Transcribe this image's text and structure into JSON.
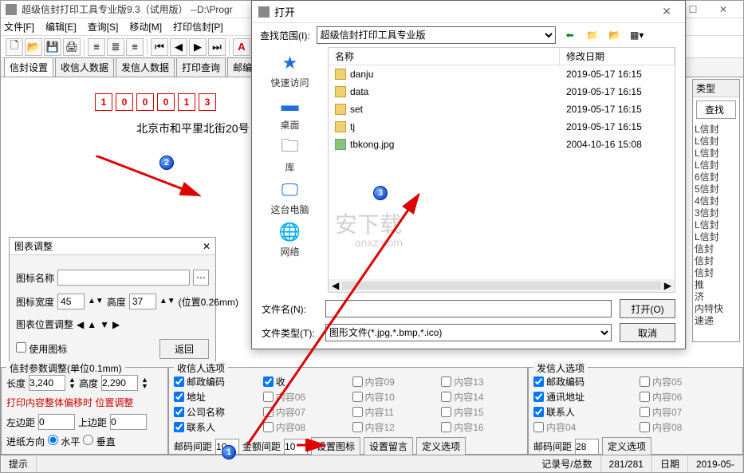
{
  "window": {
    "title": "超级信封打印工具专业版9.3（试用版）  --D:\\Progr"
  },
  "menu": [
    "文件[F]",
    "编辑[E]",
    "查询[S]",
    "移动[M]",
    "打印信封[P]"
  ],
  "tabs": [
    "信封设置",
    "收信人数据",
    "发信人数据",
    "打印查询",
    "邮编查"
  ],
  "postal": [
    "1",
    "0",
    "0",
    "0",
    "1",
    "3"
  ],
  "address": "北京市和平里北街20号",
  "chartPanel": {
    "title": "图表调整",
    "iconLabel": "图标名称",
    "widthLabel": "图标宽度",
    "widthVal": "45",
    "heightLabel": "高度",
    "heightVal": "37",
    "unit": "(位置0.26mm)",
    "posLabel": "图表位置调整",
    "useIcon": "使用图标",
    "back": "返回"
  },
  "dialog": {
    "title": "打开",
    "lookupLabel": "查找范围(I):",
    "lookupVal": "超级信封打印工具专业版",
    "side": [
      {
        "icon": "★",
        "label": "快速访问",
        "color": "#1e6fd9"
      },
      {
        "icon": "▬",
        "label": "桌面",
        "color": "#1e6fd9"
      },
      {
        "icon": "🗀",
        "label": "库",
        "color": "#555"
      },
      {
        "icon": "🖵",
        "label": "这台电脑",
        "color": "#1e6fd9"
      },
      {
        "icon": "🌐",
        "label": "网络",
        "color": "#1e6fd9"
      }
    ],
    "cols": {
      "name": "名称",
      "date": "修改日期"
    },
    "files": [
      {
        "name": "danju",
        "date": "2019-05-17 16:15",
        "type": "folder"
      },
      {
        "name": "data",
        "date": "2019-05-17 16:15",
        "type": "folder"
      },
      {
        "name": "set",
        "date": "2019-05-17 16:15",
        "type": "folder"
      },
      {
        "name": "tj",
        "date": "2019-05-17 16:15",
        "type": "folder"
      },
      {
        "name": "tbkong.jpg",
        "date": "2004-10-16 15:08",
        "type": "img"
      }
    ],
    "fileNameLabel": "文件名(N):",
    "fileTypeLabel": "文件类型(T):",
    "fileTypeVal": "图形文件(*.jpg,*.bmp,*.ico)",
    "open": "打开(O)",
    "cancel": "取消"
  },
  "p1": {
    "legend": "信封参数调整(单位0.1mm)",
    "lenLabel": "长度",
    "lenVal": "3,240",
    "hLabel": "高度",
    "hVal": "2,290",
    "offsetHint": "打印内容整体偏移时 位置调整",
    "leftLabel": "左边距",
    "leftVal": "0",
    "topLabel": "上边距",
    "topVal": "0",
    "feedLabel": "进纸方向",
    "horiz": "水平",
    "vert": "垂直"
  },
  "p2": {
    "legend": "收信人选项",
    "checks": [
      {
        "t": "邮政编码",
        "on": true
      },
      {
        "t": "收",
        "on": true
      },
      {
        "t": "内容09",
        "on": false
      },
      {
        "t": "内容13",
        "on": false
      },
      {
        "t": "地址",
        "on": true
      },
      {
        "t": "内容06",
        "on": false
      },
      {
        "t": "内容10",
        "on": false
      },
      {
        "t": "内容14",
        "on": false
      },
      {
        "t": "公司名称",
        "on": true
      },
      {
        "t": "内容07",
        "on": false
      },
      {
        "t": "内容11",
        "on": false
      },
      {
        "t": "内容15",
        "on": false
      },
      {
        "t": "联系人",
        "on": true
      },
      {
        "t": "内容08",
        "on": false
      },
      {
        "t": "内容12",
        "on": false
      },
      {
        "t": "内容16",
        "on": false
      }
    ],
    "postGapLabel": "邮码间距",
    "postGapVal": "10",
    "amtGapLabel": "金额间距",
    "amtGapVal": "10",
    "setIcon": "设置图标",
    "setMsg": "设置留言",
    "defOpt": "定义选项"
  },
  "p3": {
    "legend": "发信人选项",
    "checks": [
      {
        "t": "邮政编码",
        "on": true
      },
      {
        "t": "内容05",
        "on": false
      },
      {
        "t": "通讯地址",
        "on": true
      },
      {
        "t": "内容06",
        "on": false
      },
      {
        "t": "联系人",
        "on": true
      },
      {
        "t": "内容07",
        "on": false
      },
      {
        "t": "内容04",
        "on": false
      },
      {
        "t": "内容08",
        "on": false
      }
    ],
    "postGapLabel": "邮码间距",
    "postGapVal": "28",
    "defOpt": "定义选项"
  },
  "status": {
    "hint": "提示",
    "recLabel": "记录号/总数",
    "recVal": "281/281",
    "dateLabel": "日期",
    "dateVal": "2019-05-"
  },
  "rt": {
    "typeLabel": "类型",
    "find": "查找",
    "items": [
      "L信封",
      "L信封",
      "L信封",
      "L信封",
      "6信封",
      "5信封",
      "4信封",
      "3信封",
      "L信封",
      "L信封",
      "信封",
      "信封",
      "信封",
      "推",
      "济",
      "内特快",
      "速递"
    ]
  },
  "watermark": "安下载",
  "watermark2": "anxz.com"
}
